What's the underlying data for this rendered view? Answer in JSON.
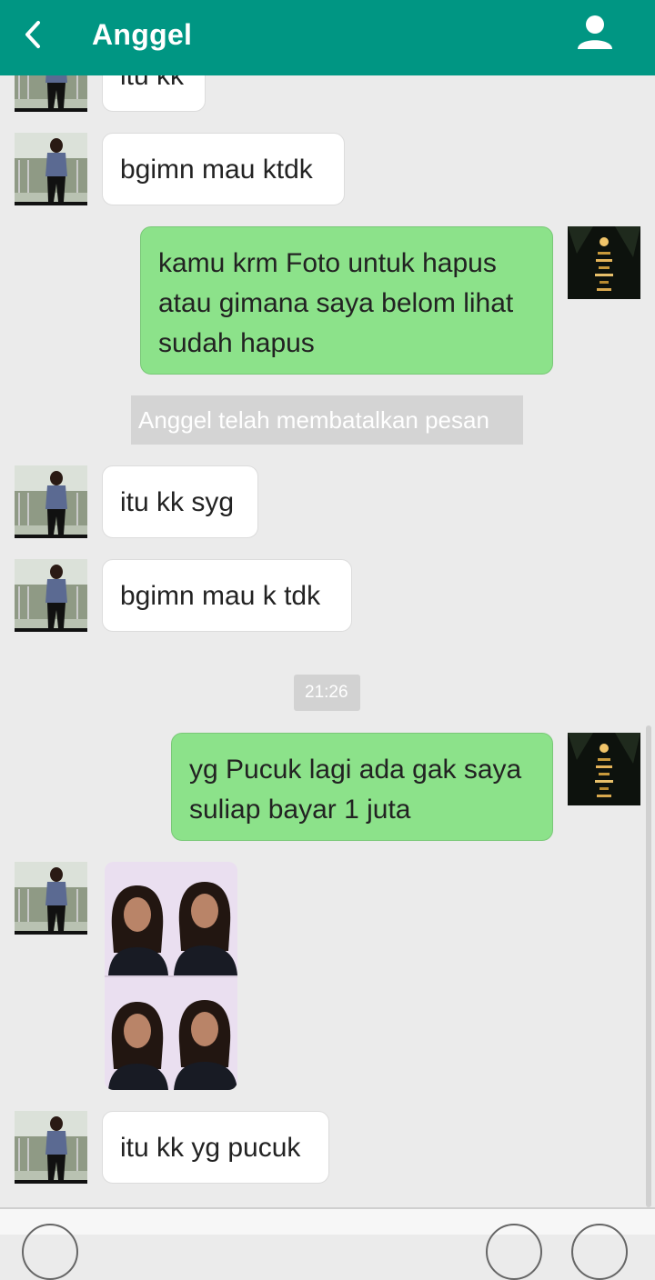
{
  "header": {
    "title": "Anggel",
    "background": "#009683",
    "back_icon": "chevron-left-icon",
    "profile_icon": "user-icon"
  },
  "messages": [
    {
      "type": "in",
      "text": "itu kk"
    },
    {
      "type": "in",
      "text": "bgimn mau ktdk"
    },
    {
      "type": "out",
      "text": "kamu krm Foto untuk hapus atau gimana saya belom lihat sudah hapus"
    },
    {
      "type": "system",
      "text": "Anggel telah membatalkan pesan"
    },
    {
      "type": "in",
      "text": "itu kk syg"
    },
    {
      "type": "in",
      "text": "bgimn mau k tdk"
    },
    {
      "type": "timestamp",
      "text": "21:26"
    },
    {
      "type": "out",
      "text": "yg Pucuk lagi ada gak saya suliap bayar 1 juta"
    },
    {
      "type": "in-image",
      "text": ""
    },
    {
      "type": "in",
      "text": "itu kk yg pucuk"
    }
  ],
  "colors": {
    "incoming_bubble": "#ffffff",
    "outgoing_bubble": "#8ce28a",
    "chat_background": "#ebebeb"
  }
}
